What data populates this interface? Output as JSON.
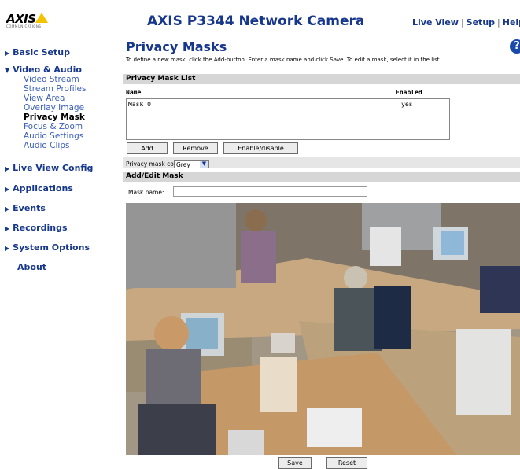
{
  "header": {
    "logo_text": "AXIS",
    "logo_subtext": "COMMUNICATIONS",
    "title": "AXIS P3344 Network Camera",
    "links": [
      "Live View",
      "Setup",
      "Help"
    ]
  },
  "sidebar": {
    "items": [
      {
        "label": "Basic Setup"
      },
      {
        "label": "Video & Audio",
        "expanded": true,
        "children": [
          "Video Stream",
          "Stream Profiles",
          "View Area",
          "Overlay Image",
          "Privacy Mask",
          "Focus & Zoom",
          "Audio Settings",
          "Audio Clips"
        ],
        "active_child": "Privacy Mask"
      },
      {
        "label": "Live View Config"
      },
      {
        "label": "Applications"
      },
      {
        "label": "Events"
      },
      {
        "label": "Recordings"
      },
      {
        "label": "System Options"
      },
      {
        "label": "About"
      }
    ]
  },
  "main": {
    "title": "Privacy Masks",
    "help_icon": "?",
    "intro": "To define a new mask, click the Add-button. Enter a mask name and click Save. To edit a mask, select it in the list.",
    "list_section": "Privacy Mask List",
    "list_columns": [
      "Name",
      "Enabled"
    ],
    "list_rows": [
      {
        "name": "Mask 0",
        "enabled": "yes"
      }
    ],
    "buttons": {
      "add": "Add",
      "remove": "Remove",
      "enable_disable": "Enable/disable"
    },
    "color_label": "Privacy mask color:",
    "color_value": "Grey",
    "edit_section": "Add/Edit Mask",
    "mask_name_label": "Mask name:",
    "mask_name_value": "",
    "save": "Save",
    "reset": "Reset"
  },
  "colors": {
    "brand_blue": "#16378b",
    "section_bar": "#d6d6d6",
    "mask_grey": "#959595",
    "logo_yellow": "#f3c300"
  },
  "icons": {
    "nav_arrow": "triangle-right-icon",
    "nav_arrow_expanded": "triangle-down-icon",
    "help": "help-icon",
    "dropdown": "chevron-down-icon"
  }
}
